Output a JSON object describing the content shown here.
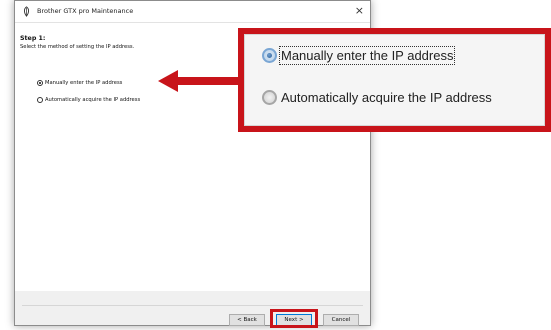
{
  "window": {
    "title": "Brother GTX pro Maintenance",
    "close_glyph": "×",
    "app_icon": "brother-feather-icon"
  },
  "content": {
    "step_label": "Step 1:",
    "instruction": "Select the method of setting the IP address.",
    "options": [
      {
        "label": "Manually enter the IP address",
        "selected": true
      },
      {
        "label": "Automatically acquire the IP address",
        "selected": false
      }
    ]
  },
  "buttons": {
    "back": "< Back",
    "next": "Next >",
    "cancel": "Cancel"
  },
  "callout": {
    "options": [
      {
        "label": "Manually enter the IP address",
        "selected": true,
        "focused": true
      },
      {
        "label": "Automatically acquire the IP address",
        "selected": false
      }
    ],
    "border_color": "#c8141a"
  }
}
